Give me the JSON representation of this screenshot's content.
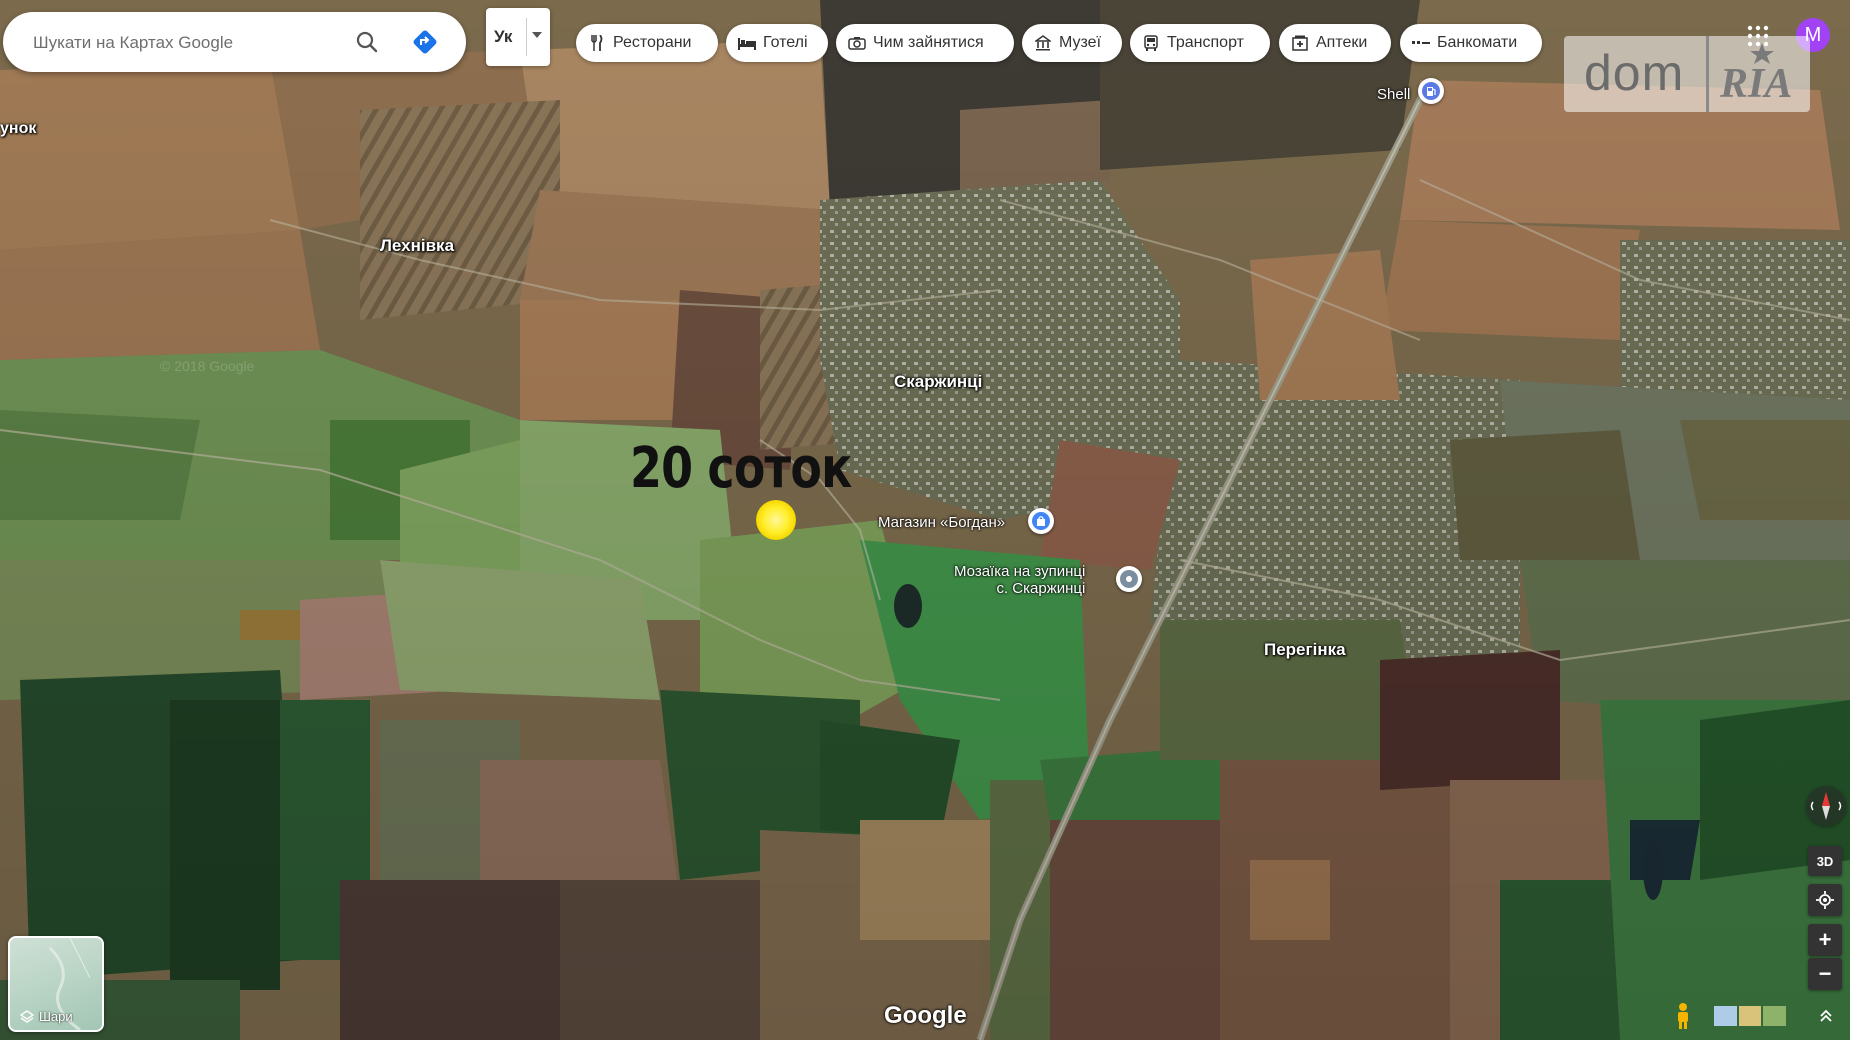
{
  "search": {
    "placeholder": "Шукати на Картах Google"
  },
  "language": {
    "label": "Ук"
  },
  "chips": [
    {
      "label": "Ресторани",
      "icon": "fork-knife-icon"
    },
    {
      "label": "Готелі",
      "icon": "bed-icon"
    },
    {
      "label": "Чим зайнятися",
      "icon": "camera-icon"
    },
    {
      "label": "Музеї",
      "icon": "museum-icon"
    },
    {
      "label": "Транспорт",
      "icon": "bus-icon"
    },
    {
      "label": "Аптеки",
      "icon": "pharmacy-icon"
    },
    {
      "label": "Банкомати",
      "icon": "atm-icon"
    }
  ],
  "watermark": {
    "left": "dom",
    "right": "RIA"
  },
  "account": {
    "initial": "M",
    "color": "#a142f4"
  },
  "map": {
    "places": [
      "Лехнівка",
      "Скаржинці",
      "Перегінка"
    ],
    "partial_label": "унок",
    "pois": [
      {
        "label": "Shell",
        "icon": "gas-station-icon",
        "color": "#5a7ae6"
      },
      {
        "label": "Магазин «Богдан»",
        "icon": "shopping-bag-icon",
        "color": "#4285f4"
      },
      {
        "label_line1": "Мозаїка на зупинці",
        "label_line2": "с. Скаржинці",
        "icon": "landmark-icon",
        "color": "#7b8ea0"
      }
    ],
    "annotation": "20 соток",
    "marker_color": "#ffee2a",
    "faint_copyright": "© 2018 Google"
  },
  "controls": {
    "layers_label": "Шари",
    "three_d": "3D",
    "zoom_in": "+",
    "zoom_out": "−"
  },
  "google_logo": "Google"
}
